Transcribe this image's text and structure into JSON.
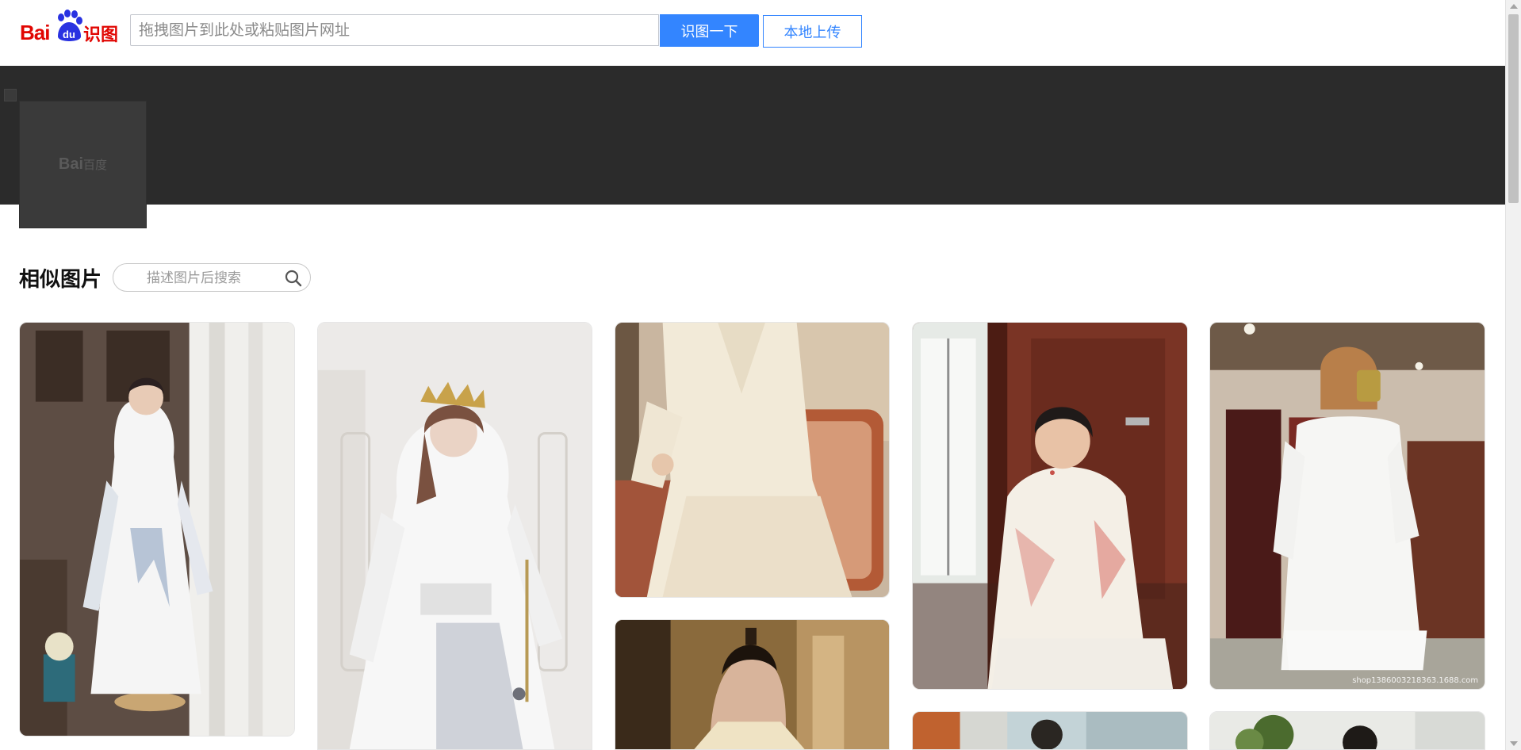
{
  "header": {
    "logo_text_latin": "Bai",
    "logo_text_du": "du",
    "logo_text_cn": "识图",
    "search_placeholder": "拖拽图片到此处或粘贴图片网址",
    "search_value": "",
    "recognize_button": "识图一下",
    "upload_button": "本地上传"
  },
  "query_image": {
    "watermark_latin": "Bai",
    "watermark_cn": "百度"
  },
  "similar": {
    "title": "相似图片",
    "search_placeholder": "描述图片后搜索"
  },
  "results": [
    {
      "name": "result-image-1",
      "watermark": ""
    },
    {
      "name": "result-image-2",
      "watermark": ""
    },
    {
      "name": "result-image-3",
      "watermark": ""
    },
    {
      "name": "result-image-4",
      "watermark": ""
    },
    {
      "name": "result-image-5",
      "watermark": "shop1386003218363.1688.com"
    },
    {
      "name": "result-image-6",
      "watermark": ""
    },
    {
      "name": "result-image-7",
      "watermark": ""
    },
    {
      "name": "result-image-8",
      "watermark": ""
    }
  ],
  "colors": {
    "brand_red": "#e10602",
    "brand_blue": "#3385ff",
    "banner_bg": "#2b2b2b"
  }
}
